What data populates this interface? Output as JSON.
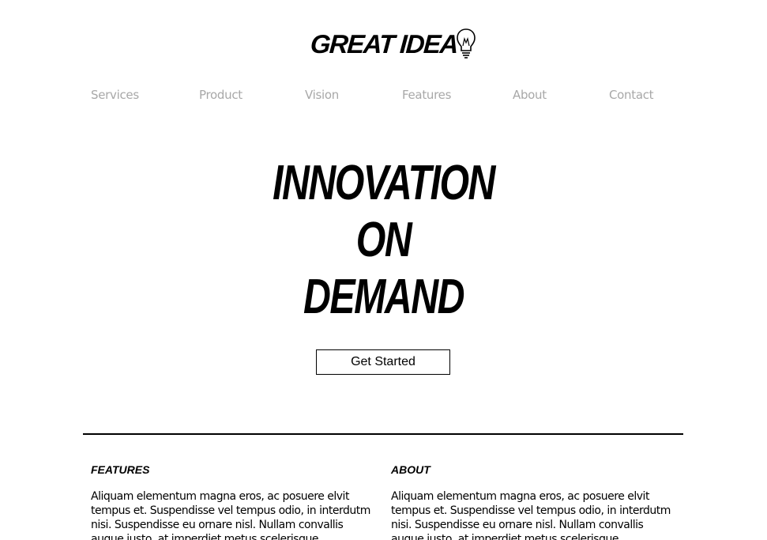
{
  "brand": {
    "logo_text": "GREAT IDEA"
  },
  "nav": {
    "items": [
      {
        "label": "Services"
      },
      {
        "label": "Product"
      },
      {
        "label": "Vision"
      },
      {
        "label": "Features"
      },
      {
        "label": "About"
      },
      {
        "label": "Contact"
      }
    ]
  },
  "hero": {
    "line1": "INNOVATION",
    "line2": "ON",
    "line3": "DEMAND",
    "cta_label": "Get Started"
  },
  "sections": [
    {
      "title": "FEATURES",
      "body": "Aliquam elementum magna eros, ac posuere elvit tempus et. Suspendisse vel tempus odio, in interdutm nisi. Suspendisse eu ornare nisl. Nullam convallis augue justo, at imperdiet metus scelerisque"
    },
    {
      "title": "ABOUT",
      "body": "Aliquam elementum magna eros, ac posuere elvit tempus et. Suspendisse vel tempus odio, in interdutm nisi. Suspendisse eu ornare nisl. Nullam convallis augue justo, at imperdiet metus scelerisque"
    }
  ],
  "colors": {
    "nav_text": "#a8a8a8",
    "text": "#000000",
    "background": "#ffffff"
  },
  "icons": {
    "logo_icon": "lightbulb-icon"
  }
}
